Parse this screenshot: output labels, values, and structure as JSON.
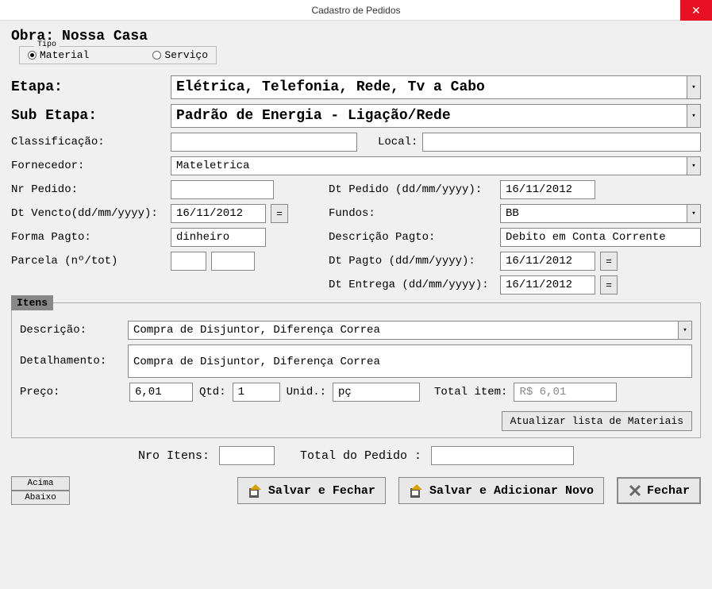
{
  "window": {
    "title": "Cadastro de Pedidos"
  },
  "obra": {
    "label": "Obra:",
    "value": "Nossa Casa"
  },
  "tipo": {
    "legend": "Tipo",
    "material": "Material",
    "servico": "Serviço"
  },
  "etapa": {
    "label": "Etapa:",
    "value": "Elétrica, Telefonia, Rede, Tv a Cabo"
  },
  "subetapa": {
    "label": "Sub Etapa:",
    "value": "Padrão de Energia - Ligação/Rede"
  },
  "classificacao": {
    "label": "Classificação:",
    "value": ""
  },
  "local": {
    "label": "Local:",
    "value": ""
  },
  "fornecedor": {
    "label": "Fornecedor:",
    "value": "Mateletrica"
  },
  "nrpedido": {
    "label": "Nr Pedido:",
    "value": ""
  },
  "dtpedido": {
    "label": "Dt Pedido (dd/mm/yyyy):",
    "value": "16/11/2012"
  },
  "dtvencto": {
    "label": "Dt Vencto(dd/mm/yyyy):",
    "value": "16/11/2012"
  },
  "fundos": {
    "label": "Fundos:",
    "value": "BB"
  },
  "formapagto": {
    "label": "Forma Pagto:",
    "value": "dinheiro"
  },
  "descpagto": {
    "label": "Descrição Pagto:",
    "value": "Debito em Conta Corrente"
  },
  "parcela": {
    "label": "Parcela  (nº/tot)",
    "v1": "",
    "v2": ""
  },
  "dtpagto": {
    "label": "Dt Pagto (dd/mm/yyyy):",
    "value": "16/11/2012"
  },
  "dtentrega": {
    "label": "Dt Entrega (dd/mm/yyyy):",
    "value": "16/11/2012"
  },
  "itens": {
    "tab": "Itens",
    "descricao_label": "Descrição:",
    "descricao": "Compra de Disjuntor, Diferença Correa",
    "detalhamento_label": "Detalhamento:",
    "detalhamento": "Compra de Disjuntor, Diferença Correa",
    "preco_label": "Preço:",
    "preco": "6,01",
    "qtd_label": "Qtd:",
    "qtd": "1",
    "unid_label": "Unid.:",
    "unid": "pç",
    "total_label": "Total item:",
    "total": "R$ 6,01",
    "atualizar_btn": "Atualizar lista de Materiais"
  },
  "totals": {
    "nroitens_label": "Nro Itens:",
    "nroitens": "",
    "totalpedido_label": "Total do Pedido :",
    "totalpedido": ""
  },
  "buttons": {
    "acima": "Acima",
    "abaixo": "Abaixo",
    "salvar_fechar": "Salvar e Fechar",
    "salvar_novo": "Salvar e Adicionar Novo",
    "fechar": "Fechar"
  }
}
